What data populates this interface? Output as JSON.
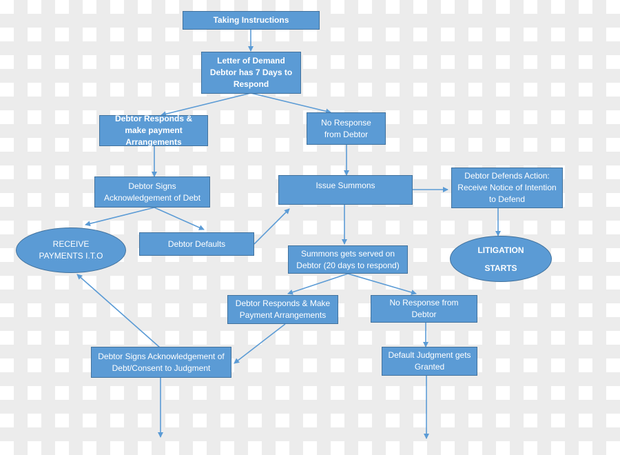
{
  "colors": {
    "node_fill": "#5b9bd5",
    "node_border": "#41719c",
    "connector": "#5b9bd5",
    "text": "#ffffff"
  },
  "nodes": {
    "taking_instructions": "Taking Instructions",
    "letter_of_demand": "Letter of Demand Debtor has 7 Days to Respond",
    "debtor_responds_payment": "Debtor Responds & make payment Arrangements",
    "no_response_1": "No Response from Debtor",
    "debtor_signs_ack": "Debtor Signs Acknowledgement of Debt",
    "issue_summons": "Issue Summons",
    "debtor_defends": "Debtor Defends Action: Receive Notice of Intention to Defend",
    "receive_payments": "RECEIVE PAYMENTS I.T.O",
    "debtor_defaults": "Debtor Defaults",
    "summons_served": "Summons gets served on Debtor (20 days to respond)",
    "litigation_starts": "LITIGATION STARTS",
    "debtor_responds_make_payment": "Debtor Responds & Make Payment Arrangements",
    "no_response_2": "No Response from Debtor",
    "debtor_signs_consent": "Debtor Signs Acknowledgement of Debt/Consent to Judgment",
    "default_judgment": "Default Judgment gets Granted"
  },
  "edges": [
    {
      "from": "taking_instructions",
      "to": "letter_of_demand"
    },
    {
      "from": "letter_of_demand",
      "to": "debtor_responds_payment"
    },
    {
      "from": "letter_of_demand",
      "to": "no_response_1"
    },
    {
      "from": "debtor_responds_payment",
      "to": "debtor_signs_ack"
    },
    {
      "from": "no_response_1",
      "to": "issue_summons"
    },
    {
      "from": "issue_summons",
      "to": "debtor_defends"
    },
    {
      "from": "debtor_signs_ack",
      "to": "receive_payments"
    },
    {
      "from": "debtor_signs_ack",
      "to": "debtor_defaults"
    },
    {
      "from": "debtor_defaults",
      "to": "issue_summons"
    },
    {
      "from": "issue_summons",
      "to": "summons_served"
    },
    {
      "from": "debtor_defends",
      "to": "litigation_starts"
    },
    {
      "from": "summons_served",
      "to": "debtor_responds_make_payment"
    },
    {
      "from": "summons_served",
      "to": "no_response_2"
    },
    {
      "from": "debtor_responds_make_payment",
      "to": "debtor_signs_consent"
    },
    {
      "from": "no_response_2",
      "to": "default_judgment"
    },
    {
      "from": "debtor_signs_consent",
      "to": "receive_payments"
    },
    {
      "from": "debtor_signs_consent",
      "to": "off-page"
    },
    {
      "from": "default_judgment",
      "to": "off-page"
    }
  ]
}
